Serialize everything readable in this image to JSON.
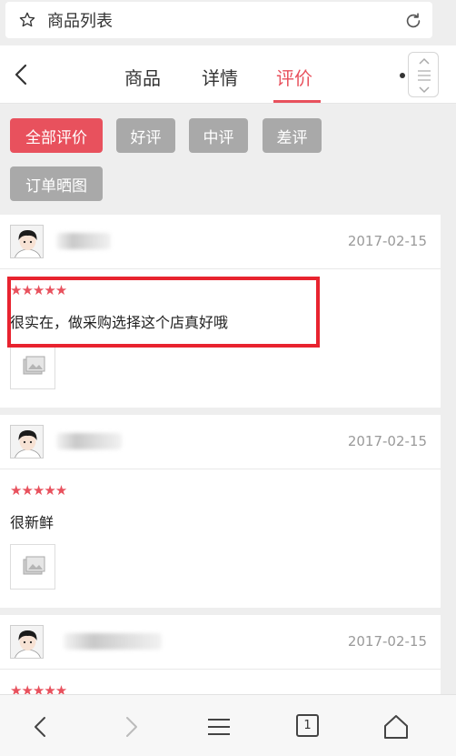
{
  "browser": {
    "title": "商品列表"
  },
  "nav": {
    "tabs": [
      "商品",
      "详情",
      "评价"
    ],
    "active_tab": "评价"
  },
  "filters": [
    "全部评价",
    "好评",
    "中评",
    "差评",
    "订单晒图"
  ],
  "reviews": [
    {
      "date": "2017-02-15",
      "rating": 5,
      "stars": "★★★★★",
      "text": "很实在，做采购选择这个店真好哦"
    },
    {
      "date": "2017-02-15",
      "rating": 5,
      "stars": "★★★★★",
      "text": "很新鲜"
    },
    {
      "date": "2017-02-15",
      "rating": 5,
      "stars": "★★★★★",
      "text": ""
    }
  ],
  "bottombar": {
    "tab_count": "1"
  },
  "colors": {
    "accent": "#e8515d",
    "filter_inactive": "#a9a9a9",
    "highlight": "#e8232f"
  }
}
